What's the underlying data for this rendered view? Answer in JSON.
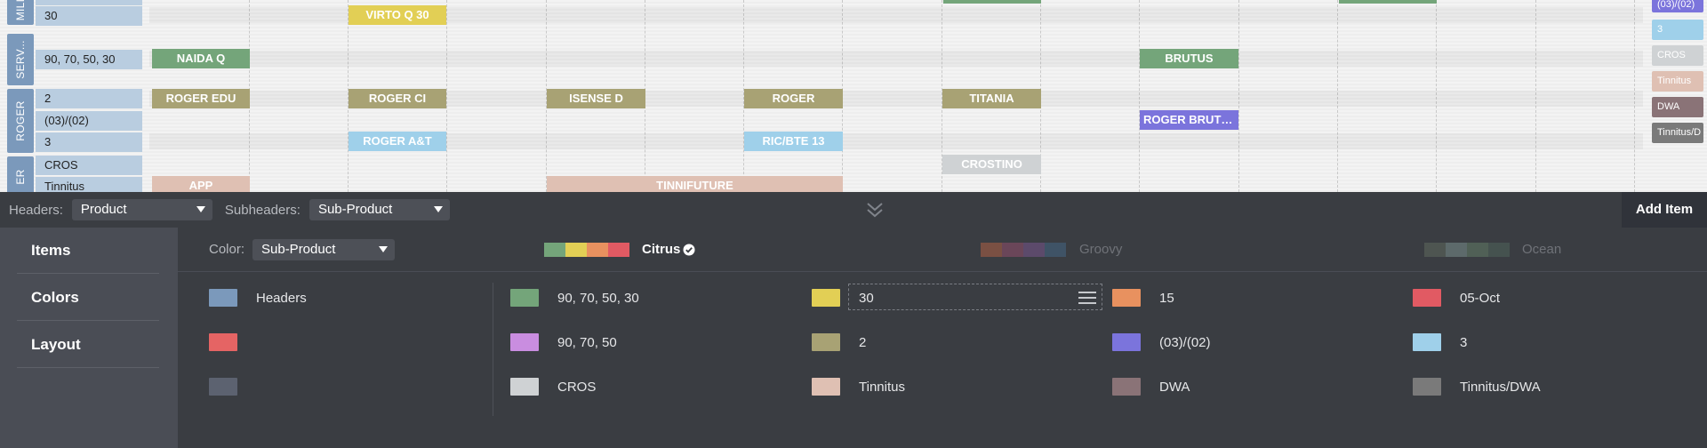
{
  "timeline": {
    "groups": [
      {
        "label": "MILI"
      },
      {
        "label": "SERV..."
      },
      {
        "label": "ROGER"
      },
      {
        "label": "ER"
      }
    ],
    "subheaders": [
      "30",
      "90, 70, 50, 30",
      "2",
      "(03)/(02)",
      "3",
      "CROS",
      "Tinnitus"
    ],
    "bars": [
      {
        "label": "VIRTO Q 30",
        "color": "#e2cf55"
      },
      {
        "label": "NAIDA Q",
        "color": "#74a57a"
      },
      {
        "label": "BRUTUS",
        "color": "#74a57a"
      },
      {
        "label": "ROGER EDU",
        "color": "#a8a274"
      },
      {
        "label": "ROGER CI",
        "color": "#a8a274"
      },
      {
        "label": "ISENSE D",
        "color": "#a8a274"
      },
      {
        "label": "ROGER",
        "color": "#a8a274"
      },
      {
        "label": "TITANIA",
        "color": "#a8a274"
      },
      {
        "label": "ROGER BRUTU...",
        "color": "#7b74dc"
      },
      {
        "label": "ROGER A&T",
        "color": "#9fd0ea"
      },
      {
        "label": "RIC/BTE 13",
        "color": "#9fd0ea"
      },
      {
        "label": "CROSTINO",
        "color": "#cfd2d4"
      },
      {
        "label": "APP",
        "color": "#dfc0b3"
      },
      {
        "label": "TINNIFUTURE",
        "color": "#dfc0b3"
      }
    ],
    "legend_chips": [
      {
        "label": "(03)/(02)",
        "color": "#7b74dc"
      },
      {
        "label": "3",
        "color": "#9fd0ea"
      },
      {
        "label": "CROS",
        "color": "#cfd2d4"
      },
      {
        "label": "Tinnitus",
        "color": "#dfc0b3"
      },
      {
        "label": "DWA",
        "color": "#8a7377"
      },
      {
        "label": "Tinnitus/D",
        "color": "#7a7a7a"
      }
    ]
  },
  "toolbar": {
    "headers_label": "Headers:",
    "headers_value": "Product",
    "subheaders_label": "Subheaders:",
    "subheaders_value": "Sub-Product",
    "add_item": "Add Item"
  },
  "sidebar": {
    "items": [
      {
        "label": "Items"
      },
      {
        "label": "Colors"
      },
      {
        "label": "Layout"
      }
    ]
  },
  "colors_panel": {
    "color_label": "Color:",
    "color_value": "Sub-Product",
    "palettes": [
      {
        "name": "Citrus",
        "selected": true,
        "colors": [
          "#74a57a",
          "#e2cf55",
          "#e8915f",
          "#e15a63"
        ]
      },
      {
        "name": "Groovy",
        "selected": false,
        "colors": [
          "#7a5043",
          "#6a4659",
          "#5c4a6b",
          "#3f5366"
        ]
      },
      {
        "name": "Ocean",
        "selected": false,
        "colors": [
          "#4e5551",
          "#5d6a6b",
          "#506056",
          "#45524f"
        ]
      }
    ],
    "header_swatches": [
      {
        "label": "Headers",
        "color": "#7b99bb"
      },
      {
        "label": "",
        "color": "#e56464"
      },
      {
        "label": "",
        "color": "#5c6270"
      }
    ],
    "swatches": [
      {
        "label": "90, 70, 50, 30",
        "color": "#74a57a"
      },
      {
        "label": "30",
        "color": "#e2cf55"
      },
      {
        "label": "15",
        "color": "#e8915f"
      },
      {
        "label": "05-Oct",
        "color": "#e15a63"
      },
      {
        "label": "90, 70, 50",
        "color": "#c98de0"
      },
      {
        "label": "2",
        "color": "#a8a274"
      },
      {
        "label": "(03)/(02)",
        "color": "#7b74dc"
      },
      {
        "label": "3",
        "color": "#9fd0ea"
      },
      {
        "label": "CROS",
        "color": "#cfd2d4"
      },
      {
        "label": "Tinnitus",
        "color": "#dfc0b3"
      },
      {
        "label": "DWA",
        "color": "#8a7377"
      },
      {
        "label": "Tinnitus/DWA",
        "color": "#7a7a7a"
      }
    ]
  }
}
